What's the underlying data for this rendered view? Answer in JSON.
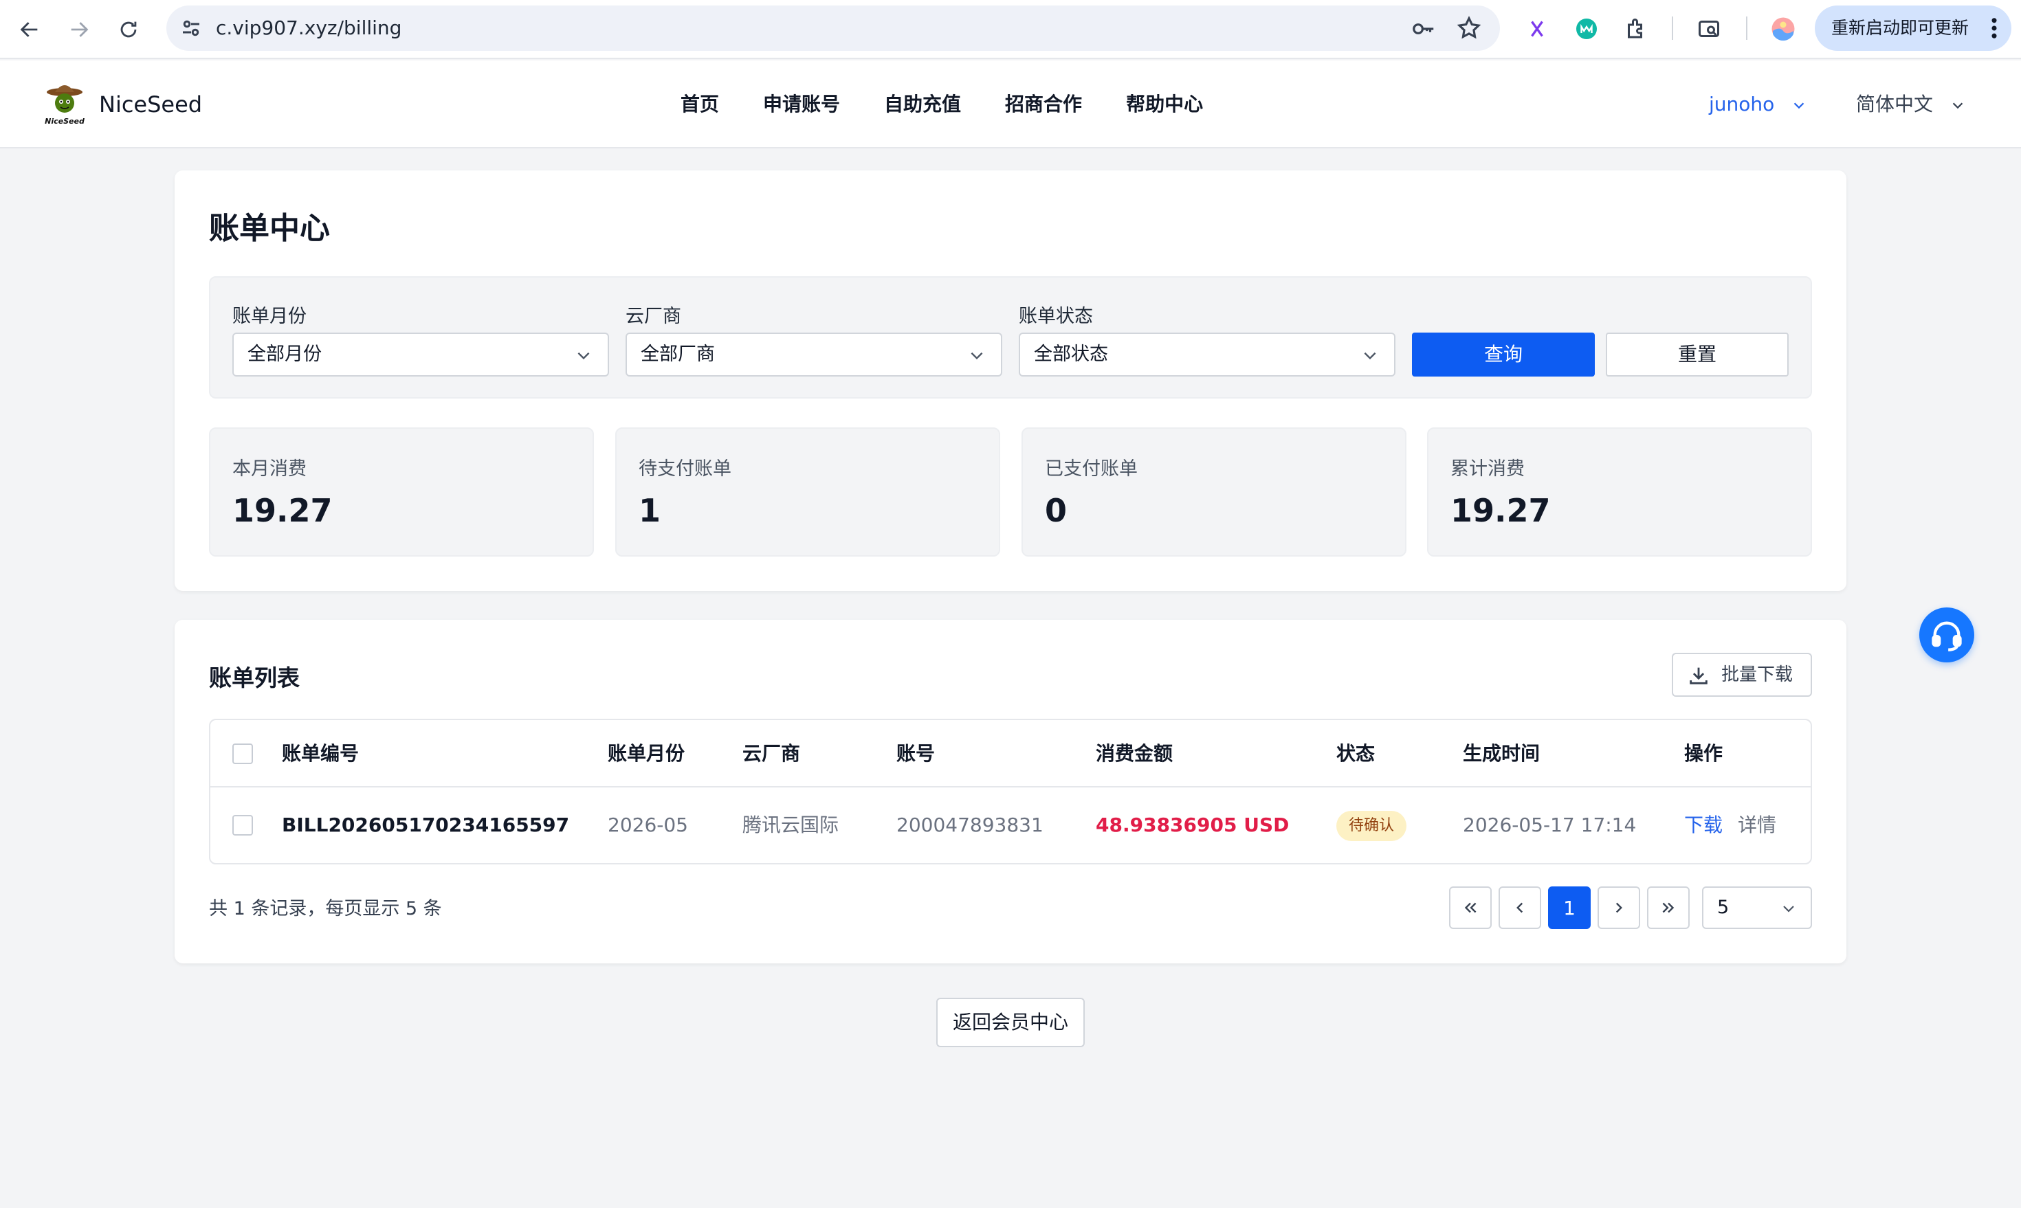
{
  "browser": {
    "url": "c.vip907.xyz/billing",
    "update_button": "重新启动即可更新"
  },
  "header": {
    "brand": "NiceSeed",
    "nav": [
      "首页",
      "申请账号",
      "自助充值",
      "招商合作",
      "帮助中心"
    ],
    "user": "junoho",
    "language": "简体中文"
  },
  "billing": {
    "title": "账单中心",
    "filters": [
      {
        "label": "账单月份",
        "value": "全部月份"
      },
      {
        "label": "云厂商",
        "value": "全部厂商"
      },
      {
        "label": "账单状态",
        "value": "全部状态"
      }
    ],
    "query_button": "查询",
    "reset_button": "重置",
    "stats": [
      {
        "label": "本月消费",
        "value": "19.27"
      },
      {
        "label": "待支付账单",
        "value": "1"
      },
      {
        "label": "已支付账单",
        "value": "0"
      },
      {
        "label": "累计消费",
        "value": "19.27"
      }
    ]
  },
  "bill_list": {
    "title": "账单列表",
    "bulk_download": "批量下载",
    "columns": [
      "账单编号",
      "账单月份",
      "云厂商",
      "账号",
      "消费金额",
      "状态",
      "生成时间",
      "操作"
    ],
    "rows": [
      {
        "id": "BILL202605170234165597",
        "month": "2026-05",
        "vendor": "腾讯云国际",
        "account": "200047893831",
        "amount": "48.93836905 USD",
        "status": "待确认",
        "created": "2026-05-17 17:14",
        "actions": [
          "下载",
          "详情"
        ]
      }
    ],
    "pagination_info": "共 1 条记录，每页显示 5 条",
    "current_page": "1",
    "page_size": "5"
  },
  "back_button": "返回会员中心",
  "colors": {
    "primary": "#0d5cf2",
    "link": "#2563eb",
    "amount": "#e11d48",
    "badge_bg": "#fdf1c4",
    "page_bg": "#f3f4f6"
  }
}
